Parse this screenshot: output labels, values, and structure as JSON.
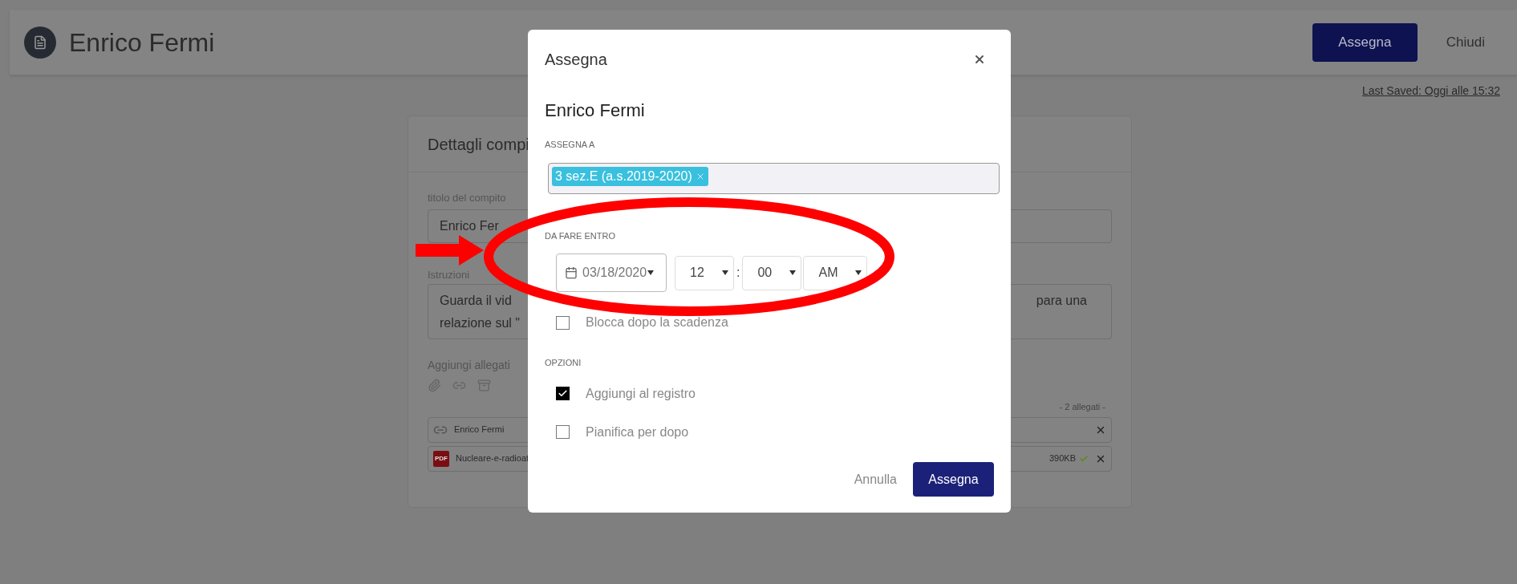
{
  "header": {
    "title": "Enrico Fermi",
    "buttons": [
      {
        "label": "Assegna",
        "kind": "primary"
      },
      {
        "label": "Chiudi",
        "kind": "link"
      }
    ],
    "last_saved": "Last Saved: Oggi alle 15:32"
  },
  "task_card": {
    "title": "Dettagli compi",
    "title_field": {
      "label": "titolo del compito",
      "value": "Enrico Fer"
    },
    "instructions": {
      "label": "Istruzioni",
      "lines_left": [
        "Guarda il vid",
        "relazione sul \""
      ],
      "line_right": "para una"
    },
    "attachments": {
      "label": "Aggiungi allegati",
      "count": "- 2 allegati -",
      "items": [
        {
          "kind": "link",
          "name": "Enrico Fermi"
        },
        {
          "kind": "pdf",
          "badge": "PDF",
          "name": "Nucleare-e-radioat",
          "size": "390KB",
          "uploaded": true
        }
      ]
    }
  },
  "modal": {
    "title": "Assegna",
    "heading": "Enrico Fermi",
    "assign_to": {
      "label": "ASSEGNA A",
      "tags": [
        "3 sez.E (a.s.2019-2020)"
      ]
    },
    "due": {
      "label": "DA FARE ENTRO",
      "date": "03/18/2020",
      "hour": "12",
      "separator": ":",
      "minute": "00",
      "period": "AM",
      "lock_after": {
        "label": "Blocca dopo la scadenza",
        "checked": false
      }
    },
    "options": {
      "label": "OPZIONI",
      "items": [
        {
          "label": "Aggiungi al registro",
          "checked": true
        },
        {
          "label": "Pianifica per dopo",
          "checked": false
        }
      ]
    },
    "buttons": [
      {
        "label": "Annulla",
        "kind": "link"
      },
      {
        "label": "Assegna",
        "kind": "primary"
      }
    ]
  }
}
